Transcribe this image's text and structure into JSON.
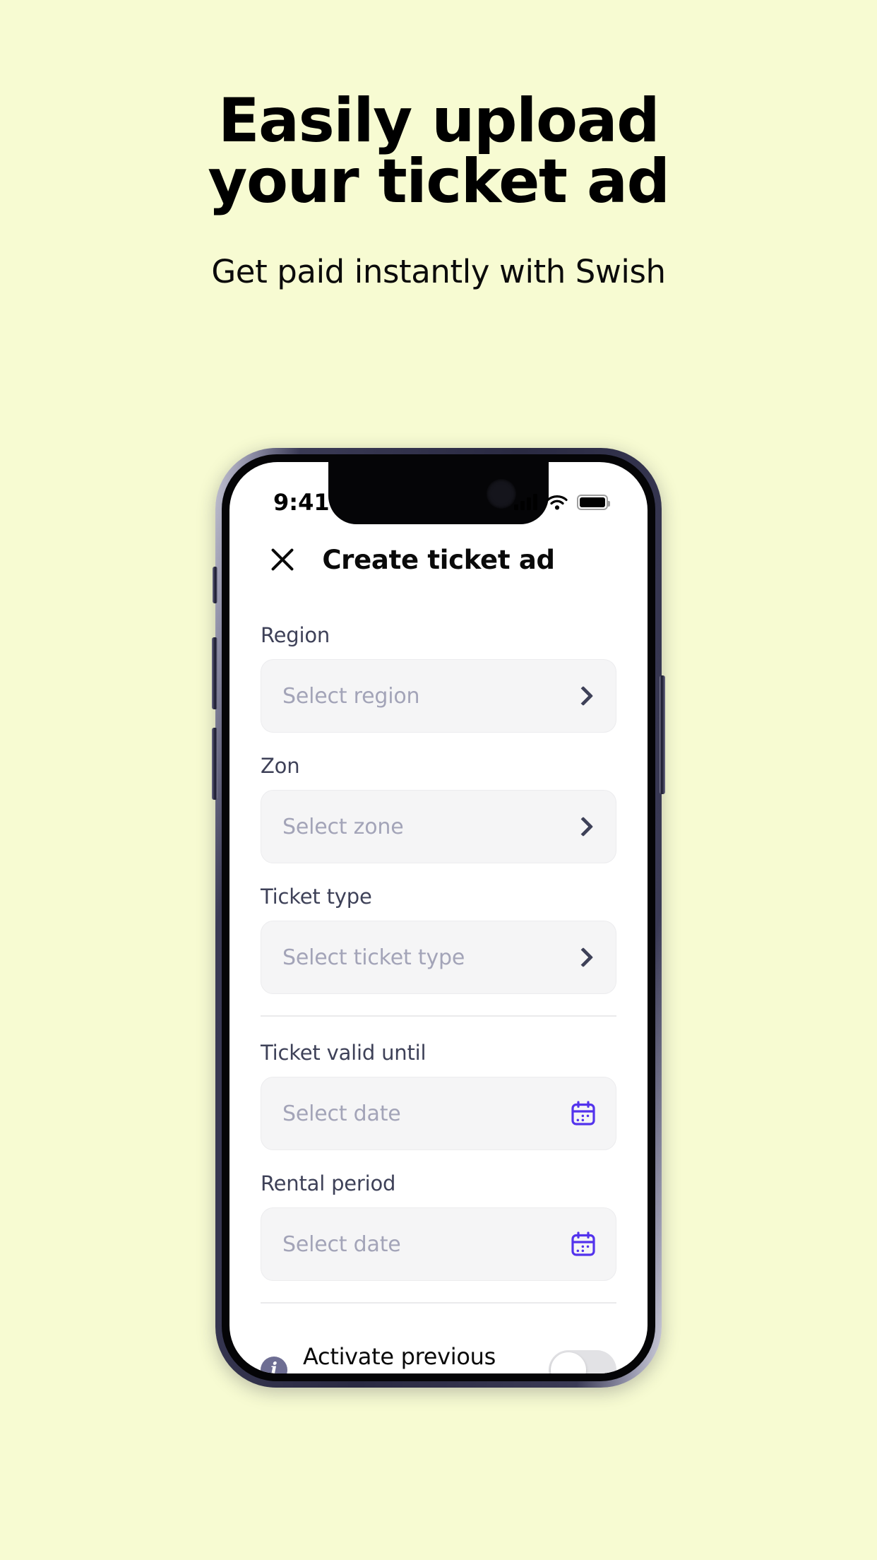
{
  "promo": {
    "title_lines": [
      "Easily upload",
      "your ticket ad"
    ],
    "subtitle": "Get paid instantly with Swish",
    "background_color": "#F7FBD2"
  },
  "phone": {
    "status_bar": {
      "time": "9:41",
      "icons": [
        "cellular-signal-icon",
        "wifi-icon",
        "battery-icon"
      ]
    },
    "header": {
      "close_label": "close-icon",
      "title": "Create ticket ad"
    },
    "form": {
      "fields": [
        {
          "label": "Region",
          "placeholder": "Select region",
          "trailing": "chevron-right-icon"
        },
        {
          "label": "Zon",
          "placeholder": "Select zone",
          "trailing": "chevron-right-icon"
        },
        {
          "label": "Ticket type",
          "placeholder": "Select ticket type",
          "trailing": "chevron-right-icon"
        },
        {
          "label": "Ticket valid until",
          "placeholder": "Select date",
          "trailing": "calendar-icon"
        },
        {
          "label": "Rental period",
          "placeholder": "Select date",
          "trailing": "calendar-icon"
        }
      ],
      "toggle_row": {
        "info_glyph": "i",
        "label": "Activate previous buyers",
        "state": "off"
      }
    },
    "accent_colors": {
      "calendar_icon": "#5333ED",
      "chevron": "#3E4158",
      "info_badge": "#6E6E93",
      "field_background": "#F5F5F6",
      "placeholder_text": "#A3A4B8",
      "label_text": "#3E4158"
    }
  }
}
